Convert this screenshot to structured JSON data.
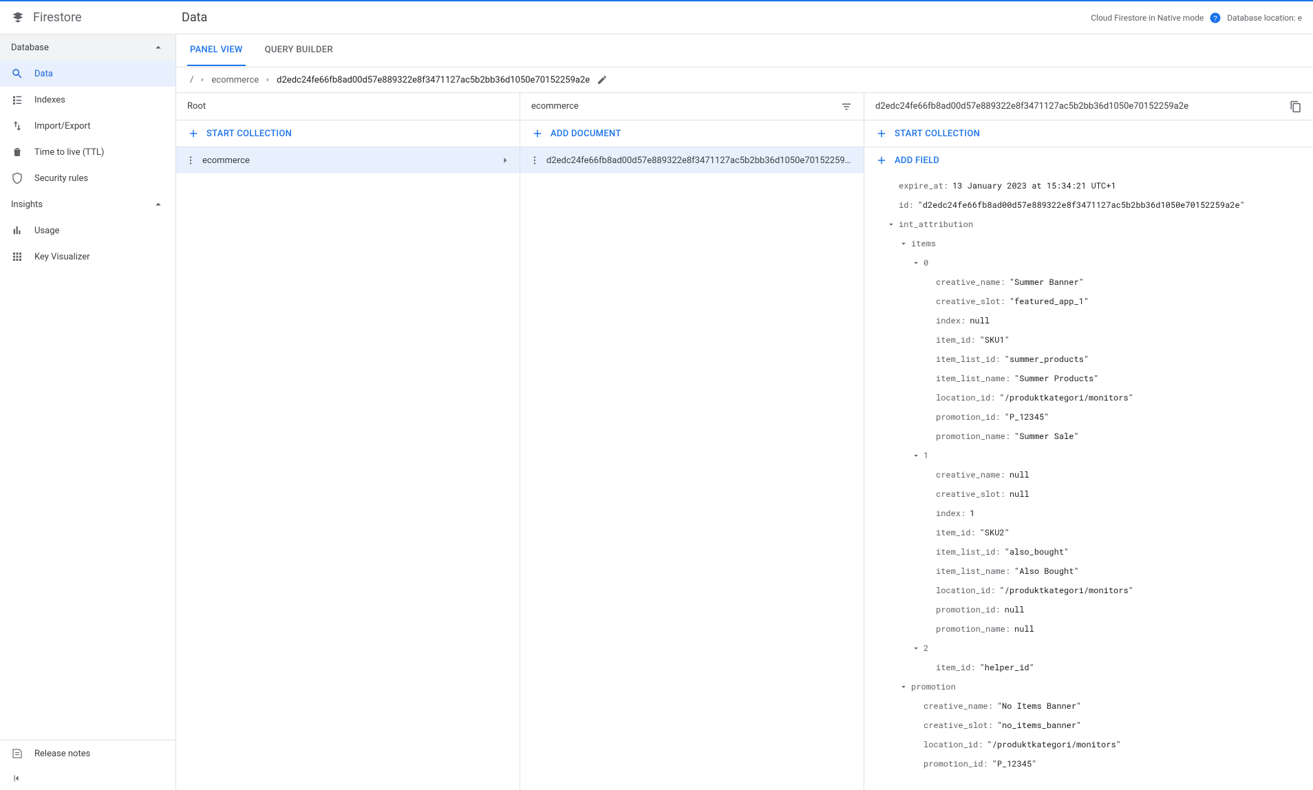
{
  "product": "Firestore",
  "page_title": "Data",
  "header_right": {
    "mode_text": "Cloud Firestore in Native mode",
    "location_label": "Database location: e"
  },
  "sidebar": {
    "sections": [
      {
        "title": "Database",
        "collapsible": true,
        "items": [
          {
            "label": "Data",
            "icon": "search",
            "active": true
          },
          {
            "label": "Indexes",
            "icon": "indexes",
            "active": false
          },
          {
            "label": "Import/Export",
            "icon": "import-export",
            "active": false
          },
          {
            "label": "Time to live (TTL)",
            "icon": "delete",
            "active": false
          },
          {
            "label": "Security rules",
            "icon": "shield",
            "active": false
          }
        ]
      },
      {
        "title": "Insights",
        "collapsible": true,
        "items": [
          {
            "label": "Usage",
            "icon": "bar-chart",
            "active": false
          },
          {
            "label": "Key Visualizer",
            "icon": "grid",
            "active": false
          }
        ]
      }
    ],
    "footer": {
      "release_notes": "Release notes"
    }
  },
  "tabs": [
    {
      "label": "Panel view",
      "active": true
    },
    {
      "label": "Query builder",
      "active": false
    }
  ],
  "breadcrumb": {
    "root": "/",
    "collection": "ecommerce",
    "doc": "d2edc24fe66fb8ad00d57e889322e8f3471127ac5b2bb36d1050e70152259a2e"
  },
  "panels": {
    "root": {
      "title": "Root",
      "action": "Start collection",
      "items": [
        {
          "label": "ecommerce"
        }
      ]
    },
    "collection": {
      "title": "ecommerce",
      "action": "Add document",
      "items": [
        {
          "label": "d2edc24fe66fb8ad00d57e889322e8f3471127ac5b2bb36d1050e70152259a2e"
        }
      ]
    },
    "document": {
      "title": "d2edc24fe66fb8ad00d57e889322e8f3471127ac5b2bb36d1050e70152259a2e",
      "action_collection": "Start collection",
      "action_field": "Add field",
      "fields": [
        {
          "indent": 1,
          "kind": "leaf",
          "key": "expire_at",
          "value": "13 January 2023 at 15:34:21 UTC+1",
          "type": "timestamp"
        },
        {
          "indent": 1,
          "kind": "leaf",
          "key": "id",
          "value": "\"d2edc24fe66fb8ad00d57e889322e8f3471127ac5b2bb36d1050e70152259a2e\"",
          "type": "string"
        },
        {
          "indent": 1,
          "kind": "node",
          "key": "int_attribution"
        },
        {
          "indent": 2,
          "kind": "node",
          "key": "items"
        },
        {
          "indent": 3,
          "kind": "node",
          "key": "0"
        },
        {
          "indent": 4,
          "kind": "leaf",
          "key": "creative_name",
          "value": "\"Summer Banner\""
        },
        {
          "indent": 4,
          "kind": "leaf",
          "key": "creative_slot",
          "value": "\"featured_app_1\""
        },
        {
          "indent": 4,
          "kind": "leaf",
          "key": "index",
          "value": "null"
        },
        {
          "indent": 4,
          "kind": "leaf",
          "key": "item_id",
          "value": "\"SKU1\""
        },
        {
          "indent": 4,
          "kind": "leaf",
          "key": "item_list_id",
          "value": "\"summer_products\""
        },
        {
          "indent": 4,
          "kind": "leaf",
          "key": "item_list_name",
          "value": "\"Summer Products\""
        },
        {
          "indent": 4,
          "kind": "leaf",
          "key": "location_id",
          "value": "\"/produktkategori/monitors\""
        },
        {
          "indent": 4,
          "kind": "leaf",
          "key": "promotion_id",
          "value": "\"P_12345\""
        },
        {
          "indent": 4,
          "kind": "leaf",
          "key": "promotion_name",
          "value": "\"Summer Sale\""
        },
        {
          "indent": 3,
          "kind": "node",
          "key": "1"
        },
        {
          "indent": 4,
          "kind": "leaf",
          "key": "creative_name",
          "value": "null"
        },
        {
          "indent": 4,
          "kind": "leaf",
          "key": "creative_slot",
          "value": "null"
        },
        {
          "indent": 4,
          "kind": "leaf",
          "key": "index",
          "value": "1"
        },
        {
          "indent": 4,
          "kind": "leaf",
          "key": "item_id",
          "value": "\"SKU2\""
        },
        {
          "indent": 4,
          "kind": "leaf",
          "key": "item_list_id",
          "value": "\"also_bought\""
        },
        {
          "indent": 4,
          "kind": "leaf",
          "key": "item_list_name",
          "value": "\"Also Bought\""
        },
        {
          "indent": 4,
          "kind": "leaf",
          "key": "location_id",
          "value": "\"/produktkategori/monitors\""
        },
        {
          "indent": 4,
          "kind": "leaf",
          "key": "promotion_id",
          "value": "null"
        },
        {
          "indent": 4,
          "kind": "leaf",
          "key": "promotion_name",
          "value": "null"
        },
        {
          "indent": 3,
          "kind": "node",
          "key": "2"
        },
        {
          "indent": 4,
          "kind": "leaf",
          "key": "item_id",
          "value": "\"helper_id\""
        },
        {
          "indent": 2,
          "kind": "node",
          "key": "promotion"
        },
        {
          "indent": 3,
          "kind": "leaf",
          "key": "creative_name",
          "value": "\"No Items Banner\""
        },
        {
          "indent": 3,
          "kind": "leaf",
          "key": "creative_slot",
          "value": "\"no_items_banner\""
        },
        {
          "indent": 3,
          "kind": "leaf",
          "key": "location_id",
          "value": "\"/produktkategori/monitors\""
        },
        {
          "indent": 3,
          "kind": "leaf",
          "key": "promotion_id",
          "value": "\"P_12345\""
        }
      ]
    }
  }
}
